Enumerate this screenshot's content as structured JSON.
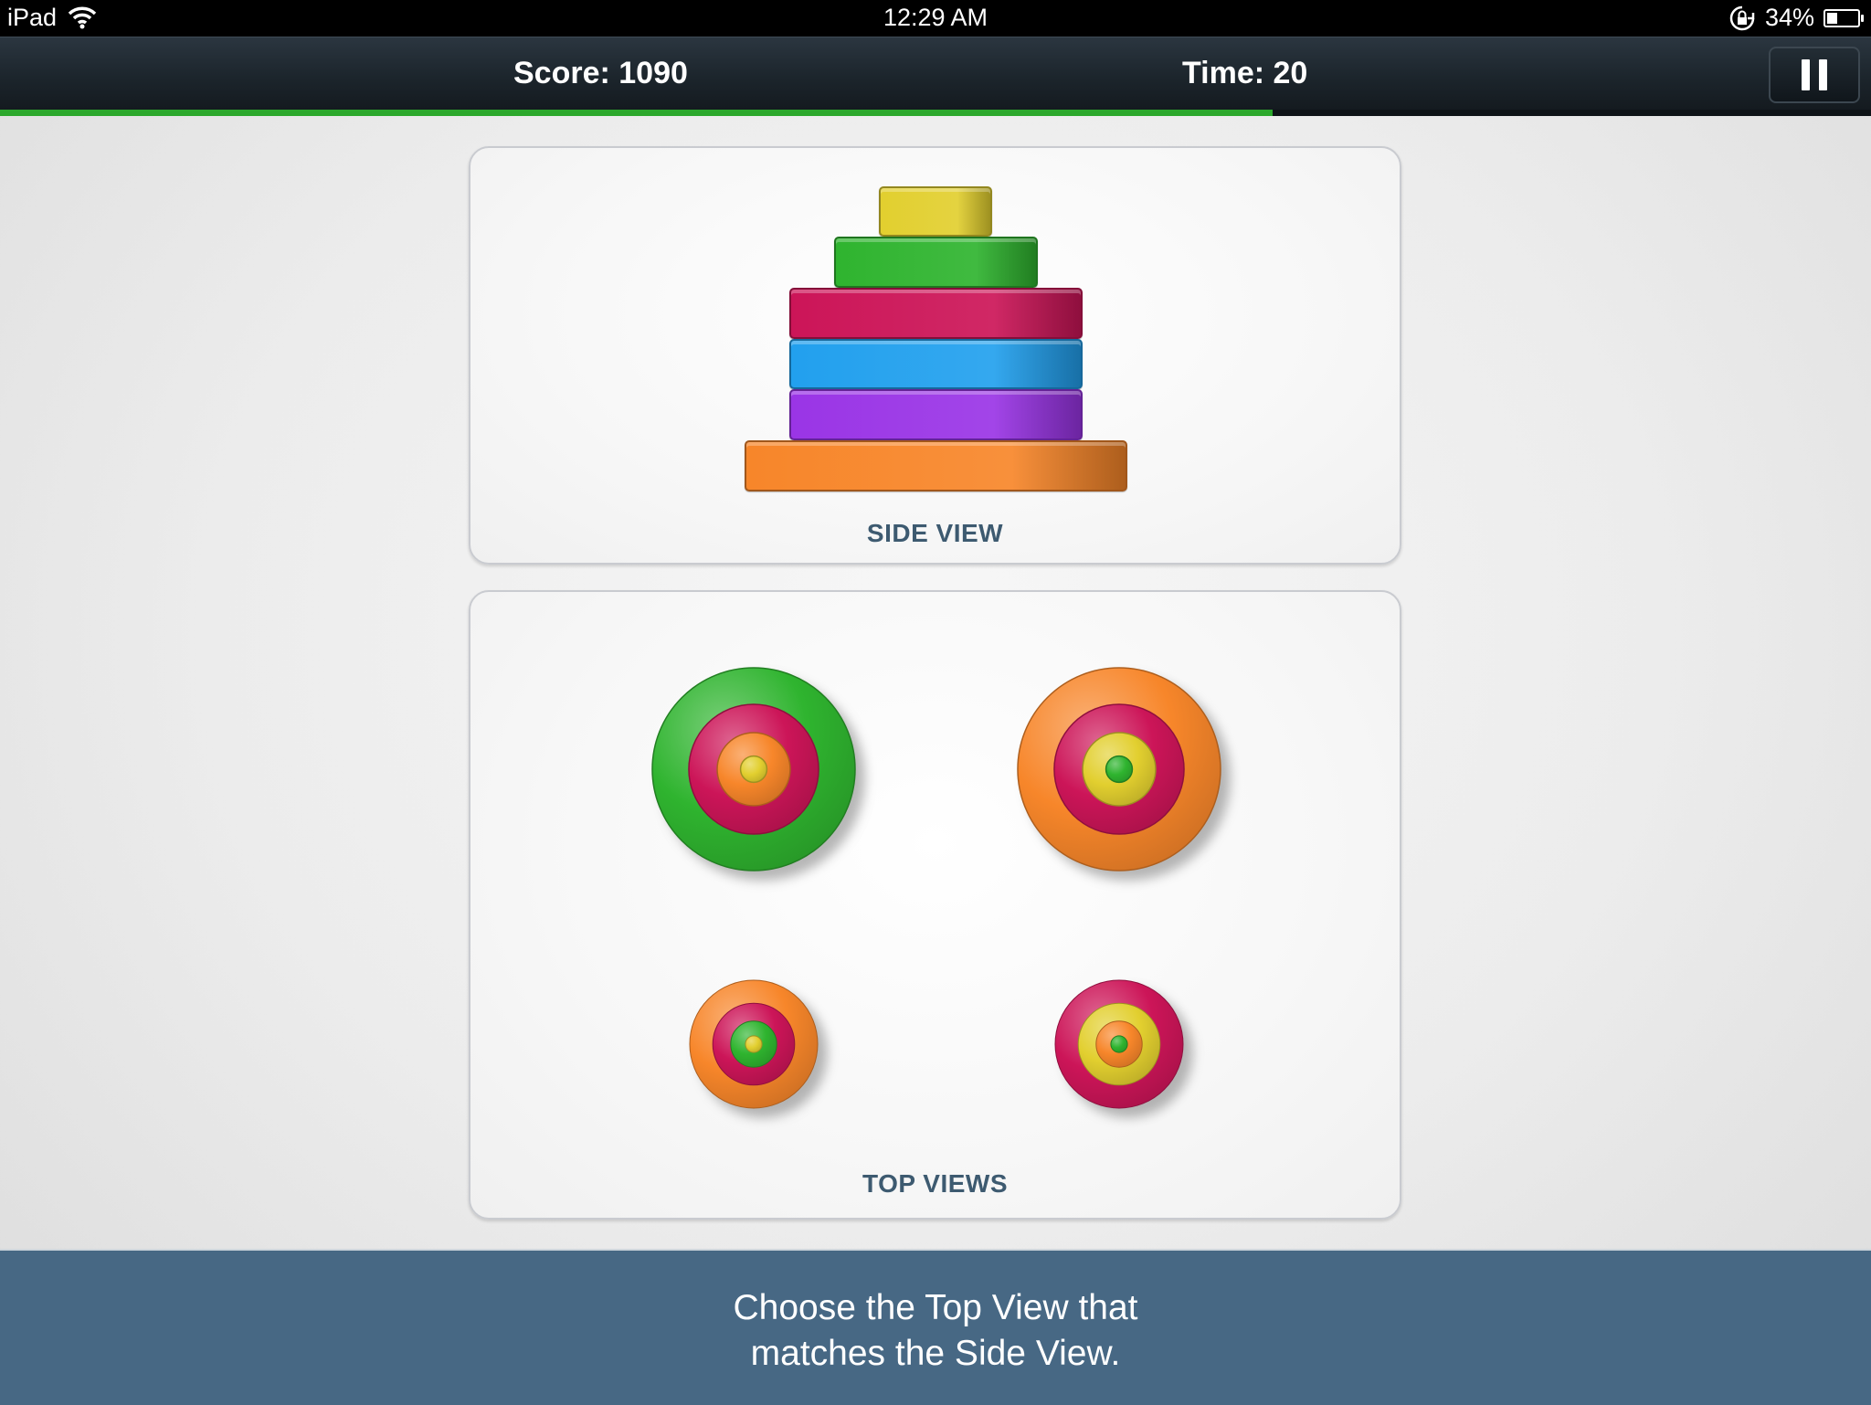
{
  "status_bar": {
    "carrier": "iPad",
    "time": "12:29 AM",
    "battery": "34%",
    "battery_level": 0.34,
    "icons": [
      "wifi-icon",
      "rotation-lock-icon",
      "battery-icon"
    ]
  },
  "game_bar": {
    "score": "Score: 1090",
    "time": "Time: 20",
    "time_progress": 0.68,
    "accent_color": "#2ca82c"
  },
  "side_view": {
    "label": "SIDE VIEW",
    "discs_top_to_bottom": [
      "yellow",
      "green",
      "crimson",
      "blue",
      "purple",
      "orange"
    ]
  },
  "top_views": {
    "label": "TOP VIEWS",
    "options": [
      {
        "name": "option-1",
        "rings_outer_to_inner": [
          "green",
          "crimson",
          "orange",
          "yellow"
        ]
      },
      {
        "name": "option-2",
        "rings_outer_to_inner": [
          "orange",
          "crimson",
          "yellow",
          "green"
        ]
      },
      {
        "name": "option-3",
        "rings_outer_to_inner": [
          "orange",
          "crimson",
          "green",
          "yellow"
        ]
      },
      {
        "name": "option-4",
        "rings_outer_to_inner": [
          "crimson",
          "yellow",
          "orange",
          "green"
        ]
      }
    ]
  },
  "colors": {
    "yellow": "#e2cf2f",
    "green": "#2fb42f",
    "crimson": "#cc1558",
    "blue": "#22a0ee",
    "purple": "#9a35e6",
    "orange": "#f7862a"
  },
  "instruction": {
    "line1": "Choose the Top View that",
    "line2": "matches the Side View."
  }
}
